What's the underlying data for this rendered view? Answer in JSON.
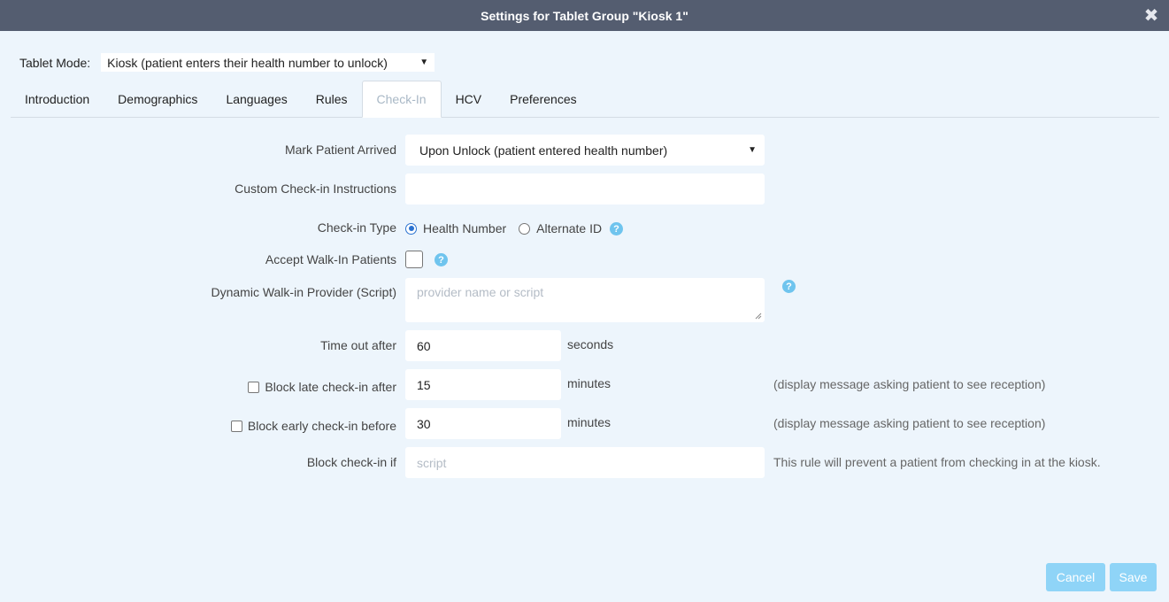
{
  "title": "Settings for Tablet Group \"Kiosk 1\"",
  "close_icon": "close-icon",
  "tablet_mode": {
    "label": "Tablet Mode:",
    "value": "Kiosk (patient enters their health number to unlock)"
  },
  "tabs": [
    "Introduction",
    "Demographics",
    "Languages",
    "Rules",
    "Check-In",
    "HCV",
    "Preferences"
  ],
  "active_tab": "Check-In",
  "form": {
    "mark_arrived": {
      "label": "Mark Patient Arrived",
      "value": "Upon Unlock (patient entered health number)"
    },
    "custom_instructions": {
      "label": "Custom Check-in Instructions",
      "value": ""
    },
    "checkin_type": {
      "label": "Check-in Type",
      "opt1": "Health Number",
      "opt2": "Alternate ID",
      "selected": "Health Number"
    },
    "walk_in": {
      "label": "Accept Walk-In Patients",
      "checked": false
    },
    "dynamic_provider": {
      "label": "Dynamic Walk-in Provider (Script)",
      "placeholder": "provider name or script"
    },
    "timeout": {
      "label": "Time out after",
      "value": "60",
      "unit": "seconds"
    },
    "block_late": {
      "label": "Block late check-in after",
      "value": "15",
      "unit": "minutes",
      "note": "(display message asking patient to see reception)",
      "checked": false
    },
    "block_early": {
      "label": "Block early check-in before",
      "value": "30",
      "unit": "minutes",
      "note": "(display message asking patient to see reception)",
      "checked": false
    },
    "block_if": {
      "label": "Block check-in if",
      "placeholder": "script",
      "note": "This rule will prevent a patient from checking in at the kiosk."
    }
  },
  "buttons": {
    "cancel": "Cancel",
    "save": "Save"
  },
  "colors": {
    "titlebar": "#545d70",
    "background": "#edf5fc",
    "accent": "#8fd4f7",
    "help": "#6fc4ee"
  }
}
